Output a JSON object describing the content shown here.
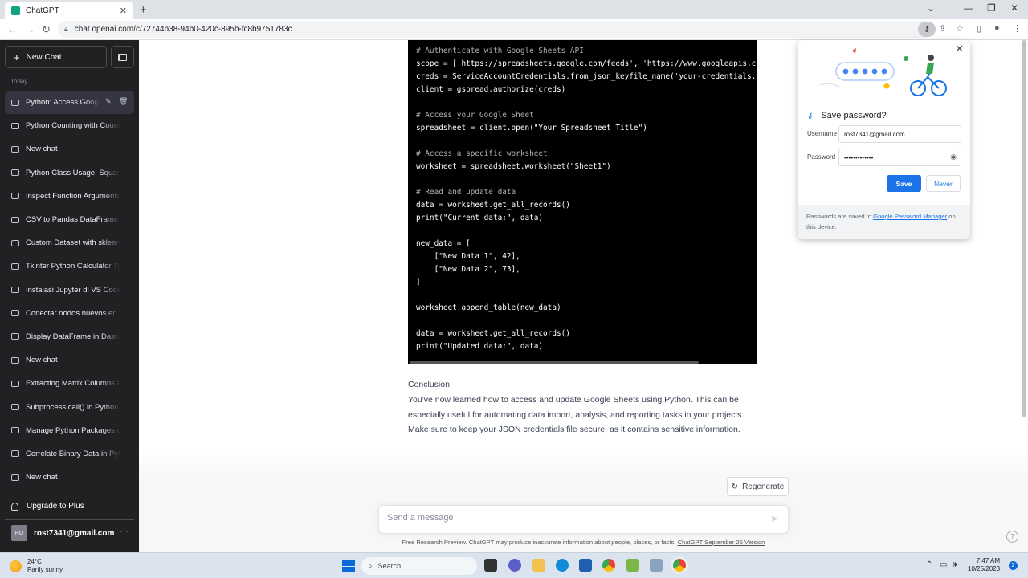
{
  "browser": {
    "tab_title": "ChatGPT",
    "url": "chat.openai.com/c/72744b38-94b0-420c-895b-fc8b9751783c"
  },
  "sidebar": {
    "new_chat_label": "New Chat",
    "section_label": "Today",
    "chats": [
      "Python: Access Google Sheets",
      "Python Counting with Counter",
      "New chat",
      "Python Class Usage: Square",
      "Inspect Function Arguments",
      "CSV to Pandas DataFrame",
      "Custom Dataset with sklearn",
      "Tkinter Python Calculator Tutorial",
      "Instalasi Jupyter di VS Code",
      "Conectar nodos nuevos en N",
      "Display DataFrame in Dash",
      "New chat",
      "Extracting Matrix Columns P",
      "Subprocess.call() in Python T",
      "Manage Python Packages on",
      "Correlate Binary Data in Python",
      "New chat"
    ],
    "upgrade_label": "Upgrade to Plus",
    "account_initials": "RO",
    "account_email": "rost7341@gmail.com"
  },
  "code": {
    "lines": [
      {
        "text": "# Authenticate with Google Sheets API",
        "cls": "comment"
      },
      {
        "text": "scope = ['https://spreadsheets.google.com/feeds', 'https://www.googleapis.co",
        "cls": ""
      },
      {
        "text": "creds = ServiceAccountCredentials.from_json_keyfile_name('your-credentials.j",
        "cls": ""
      },
      {
        "text": "client = gspread.authorize(creds)",
        "cls": ""
      },
      {
        "text": "",
        "cls": ""
      },
      {
        "text": "# Access your Google Sheet",
        "cls": "comment"
      },
      {
        "text": "spreadsheet = client.open(\"Your Spreadsheet Title\")",
        "cls": ""
      },
      {
        "text": "",
        "cls": ""
      },
      {
        "text": "# Access a specific worksheet",
        "cls": "comment"
      },
      {
        "text": "worksheet = spreadsheet.worksheet(\"Sheet1\")",
        "cls": ""
      },
      {
        "text": "",
        "cls": ""
      },
      {
        "text": "# Read and update data",
        "cls": "comment"
      },
      {
        "text": "data = worksheet.get_all_records()",
        "cls": ""
      },
      {
        "text": "print(\"Current data:\", data)",
        "cls": ""
      },
      {
        "text": "",
        "cls": ""
      },
      {
        "text": "new_data = [",
        "cls": ""
      },
      {
        "text": "    [\"New Data 1\", 42],",
        "cls": ""
      },
      {
        "text": "    [\"New Data 2\", 73],",
        "cls": ""
      },
      {
        "text": "]",
        "cls": ""
      },
      {
        "text": "",
        "cls": ""
      },
      {
        "text": "worksheet.append_table(new_data)",
        "cls": ""
      },
      {
        "text": "",
        "cls": ""
      },
      {
        "text": "data = worksheet.get_all_records()",
        "cls": ""
      },
      {
        "text": "print(\"Updated data:\", data)",
        "cls": ""
      }
    ]
  },
  "conclusion": {
    "heading": "Conclusion:",
    "body": "You've now learned how to access and update Google Sheets using Python. This can be especially useful for automating data import, analysis, and reporting tasks in your projects. Make sure to keep your JSON credentials file secure, as it contains sensitive information."
  },
  "composer": {
    "regenerate_label": "Regenerate",
    "placeholder": "Send a message",
    "footer_text": "Free Research Preview. ChatGPT may produce inaccurate information about people, places, or facts. ",
    "footer_link": "ChatGPT September 25 Version"
  },
  "password_prompt": {
    "title": "Save password?",
    "username_label": "Username",
    "username_value": "rost7341@gmail.com",
    "password_label": "Password",
    "password_mask": "•••••••••••••",
    "save_label": "Save",
    "never_label": "Never",
    "footer_prefix": "Passwords are saved to ",
    "footer_link": "Google Password Manager",
    "footer_suffix": " on this device."
  },
  "taskbar": {
    "temperature": "24°C",
    "weather": "Partly sunny",
    "search_label": "Search",
    "time": "7:47 AM",
    "date": "10/25/2023",
    "notification_count": "2"
  },
  "colors": {
    "sidebar_bg": "#202123",
    "save_button": "#1a73e8",
    "code_bg": "#000000"
  }
}
